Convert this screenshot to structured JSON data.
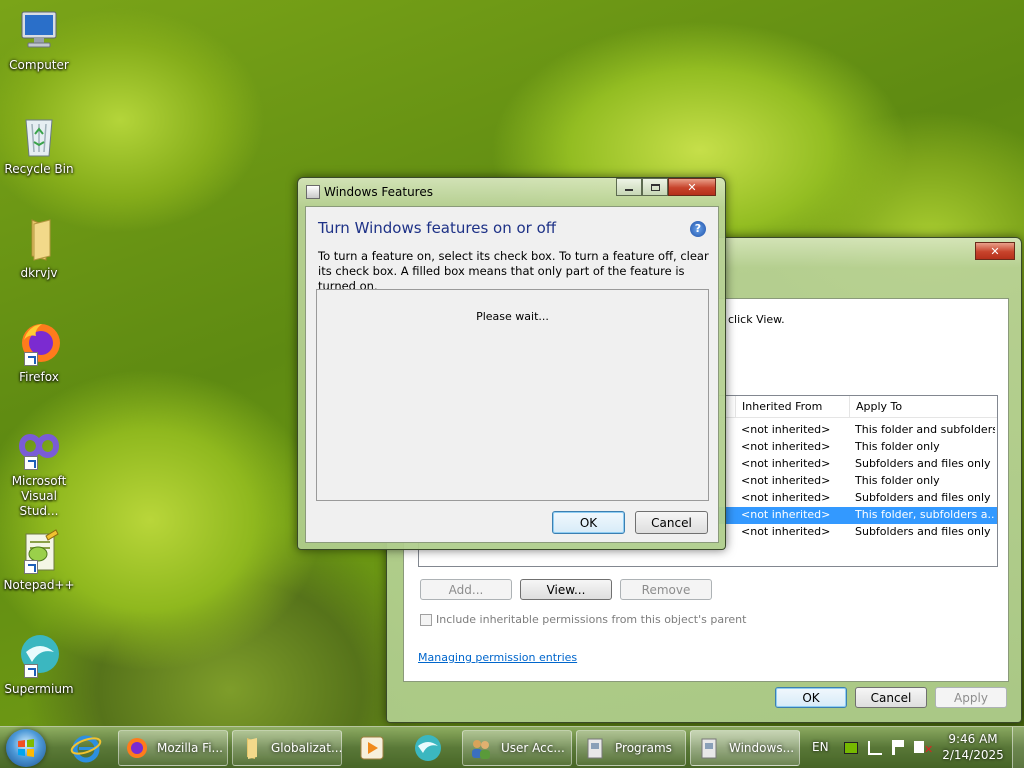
{
  "desktop": {
    "icons": [
      {
        "label": "Computer"
      },
      {
        "label": "Recycle Bin"
      },
      {
        "label": "dkrvjv"
      },
      {
        "label": "Firefox"
      },
      {
        "label": "Microsoft Visual Stud..."
      },
      {
        "label": "Notepad++"
      },
      {
        "label": "Supermium"
      }
    ]
  },
  "features_dialog": {
    "title": "Windows Features",
    "heading": "Turn Windows features on or off",
    "description": "To turn a feature on, select its check box. To turn a feature off, clear its check box. A filled box means that only part of the feature is turned on.",
    "status": "Please wait...",
    "ok_label": "OK",
    "cancel_label": "Cancel",
    "help_glyph": "?"
  },
  "security_dialog": {
    "partial_text": "click View.",
    "columns": [
      "Inherited From",
      "Apply To"
    ],
    "rows": [
      {
        "inherited": "<not inherited>",
        "apply": "This folder and subfolders",
        "selected": false
      },
      {
        "inherited": "<not inherited>",
        "apply": "This folder only",
        "selected": false
      },
      {
        "inherited": "<not inherited>",
        "apply": "Subfolders and files only",
        "selected": false
      },
      {
        "inherited": "<not inherited>",
        "apply": "This folder only",
        "selected": false
      },
      {
        "inherited": "<not inherited>",
        "apply": "Subfolders and files only",
        "selected": false
      },
      {
        "inherited": "<not inherited>",
        "apply": "This folder, subfolders a...",
        "selected": true
      },
      {
        "inherited": "<not inherited>",
        "apply": "Subfolders and files only",
        "selected": false
      }
    ],
    "add_label": "Add...",
    "view_label": "View...",
    "remove_label": "Remove",
    "inherit_checkbox_label": "Include inheritable permissions from this object's parent",
    "link_label": "Managing permission entries",
    "ok_label": "OK",
    "cancel_label": "Cancel",
    "apply_label": "Apply"
  },
  "taskbar": {
    "items": [
      {
        "label": "Mozilla Fi..."
      },
      {
        "label": "Globalizat..."
      },
      {
        "label": "User Acc..."
      },
      {
        "label": "Programs"
      },
      {
        "label": "Windows..."
      }
    ],
    "language": "EN",
    "time": "9:46 AM",
    "date": "2/14/2025"
  },
  "colors": {
    "selection": "#3399ff",
    "link": "#0066cc",
    "heading": "#1e3287",
    "close_button": "#c7432b"
  }
}
